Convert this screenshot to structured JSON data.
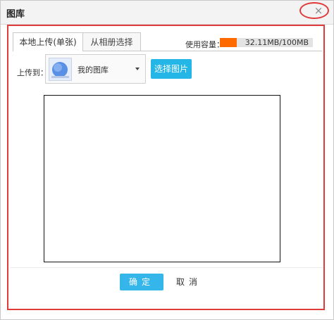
{
  "window": {
    "title": "图库",
    "close_symbol": "×",
    "highlight_color": "#e03a3a"
  },
  "tabs": [
    {
      "label": "本地上传(单张)",
      "active": true
    },
    {
      "label": "从相册选择",
      "active": false
    }
  ],
  "usage": {
    "label": "使用容量：",
    "value_text": "32.11MB/100MB",
    "used_fraction": 0.1811,
    "fill_color": "#ff6a00",
    "track_color": "#e3e3e3"
  },
  "upload": {
    "label": "上传到：",
    "album_name": "我的图库",
    "album_thumbnail_icon": "album-thumbnail-icon",
    "dropdown_icon": "chevron-down-icon",
    "select_button_label": "选择图片",
    "select_button_color": "#23b6e6"
  },
  "actions": {
    "ok_label": "确定",
    "cancel_label": "取消",
    "ok_color": "#34b6ea"
  }
}
